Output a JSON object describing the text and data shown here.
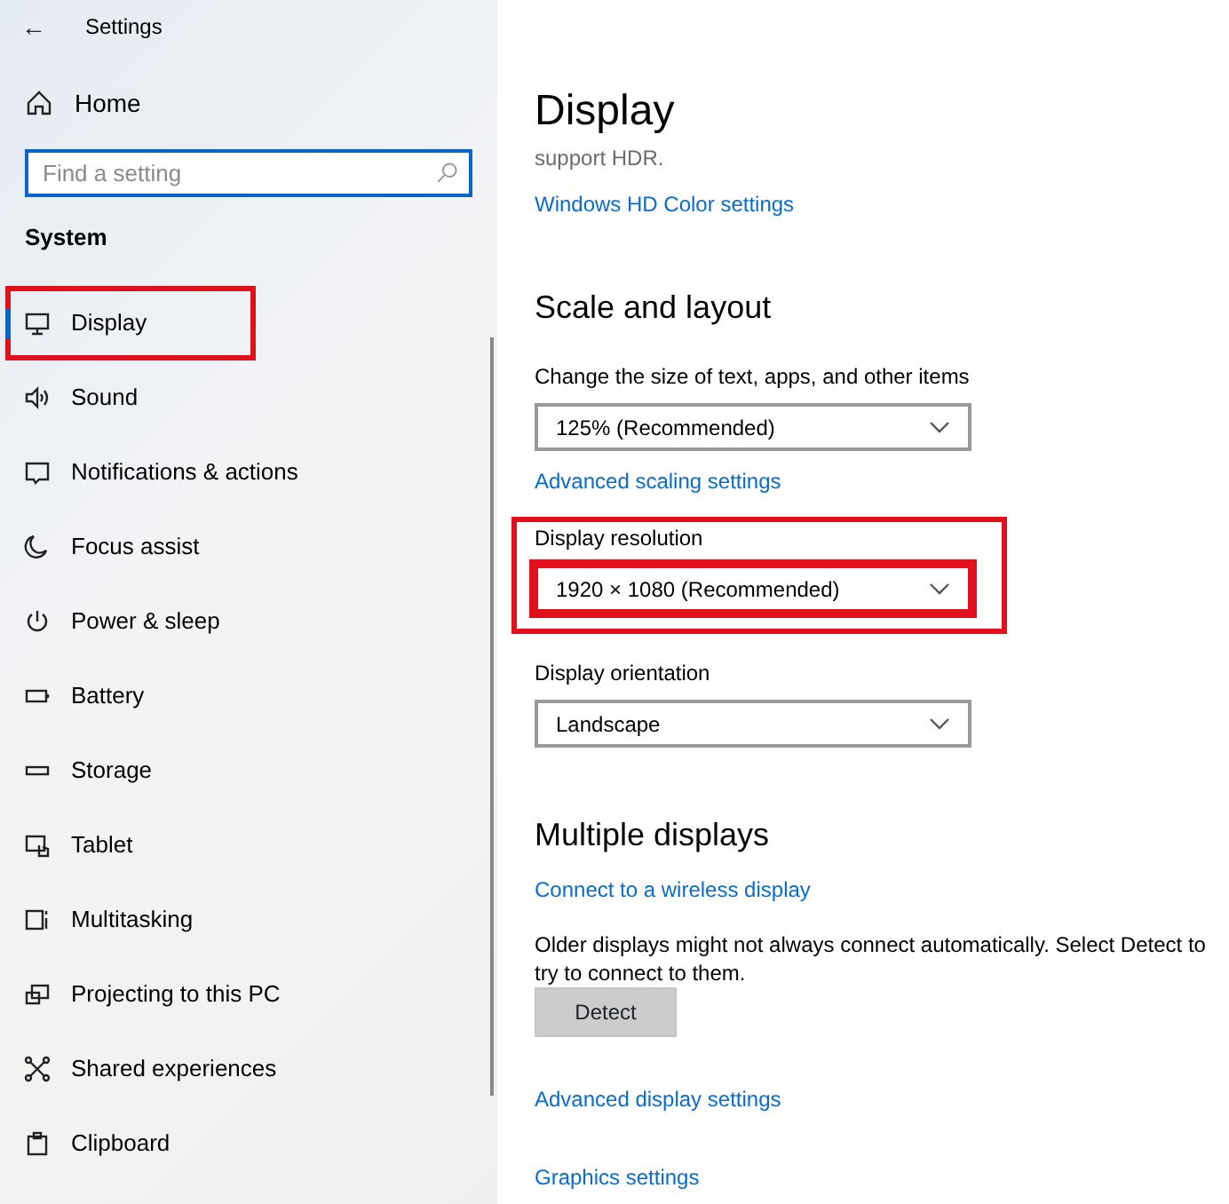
{
  "window": {
    "title": "Settings",
    "back": "←"
  },
  "sidebar": {
    "home": "Home",
    "search": {
      "placeholder": "Find a setting"
    },
    "section": "System",
    "items": [
      {
        "label": "Display",
        "selected": true,
        "highlighted": true
      },
      {
        "label": "Sound",
        "selected": false,
        "highlighted": false
      },
      {
        "label": "Notifications & actions",
        "selected": false,
        "highlighted": false
      },
      {
        "label": "Focus assist",
        "selected": false,
        "highlighted": false
      },
      {
        "label": "Power & sleep",
        "selected": false,
        "highlighted": false
      },
      {
        "label": "Battery",
        "selected": false,
        "highlighted": false
      },
      {
        "label": "Storage",
        "selected": false,
        "highlighted": false
      },
      {
        "label": "Tablet",
        "selected": false,
        "highlighted": false
      },
      {
        "label": "Multitasking",
        "selected": false,
        "highlighted": false
      },
      {
        "label": "Projecting to this PC",
        "selected": false,
        "highlighted": false
      },
      {
        "label": "Shared experiences",
        "selected": false,
        "highlighted": false
      },
      {
        "label": "Clipboard",
        "selected": false,
        "highlighted": false
      }
    ]
  },
  "content": [
    {
      "kind": "title",
      "text": "Display"
    },
    {
      "kind": "note",
      "text": "support HDR."
    },
    {
      "kind": "link",
      "text": "Windows HD Color settings"
    },
    {
      "kind": "heading",
      "text": "Scale and layout"
    },
    {
      "kind": "label",
      "text": "Change the size of text, apps, and other items"
    },
    {
      "kind": "dropdown",
      "value": "125% (Recommended)",
      "highlighted": false
    },
    {
      "kind": "link",
      "text": "Advanced scaling settings"
    },
    {
      "kind": "group",
      "highlighted": true,
      "items": [
        {
          "kind": "label",
          "text": "Display resolution"
        },
        {
          "kind": "dropdown",
          "value": "1920 × 1080 (Recommended)",
          "highlighted": true
        }
      ]
    },
    {
      "kind": "label",
      "text": "Display orientation"
    },
    {
      "kind": "dropdown",
      "value": "Landscape",
      "highlighted": false
    },
    {
      "kind": "heading",
      "text": "Multiple displays"
    },
    {
      "kind": "link",
      "text": "Connect to a wireless display"
    },
    {
      "kind": "paragraph",
      "text": "Older displays might not always connect automatically. Select Detect to try to connect to them."
    },
    {
      "kind": "button",
      "text": "Detect"
    },
    {
      "kind": "link",
      "text": "Advanced display settings"
    },
    {
      "kind": "link",
      "text": "Graphics settings"
    }
  ]
}
